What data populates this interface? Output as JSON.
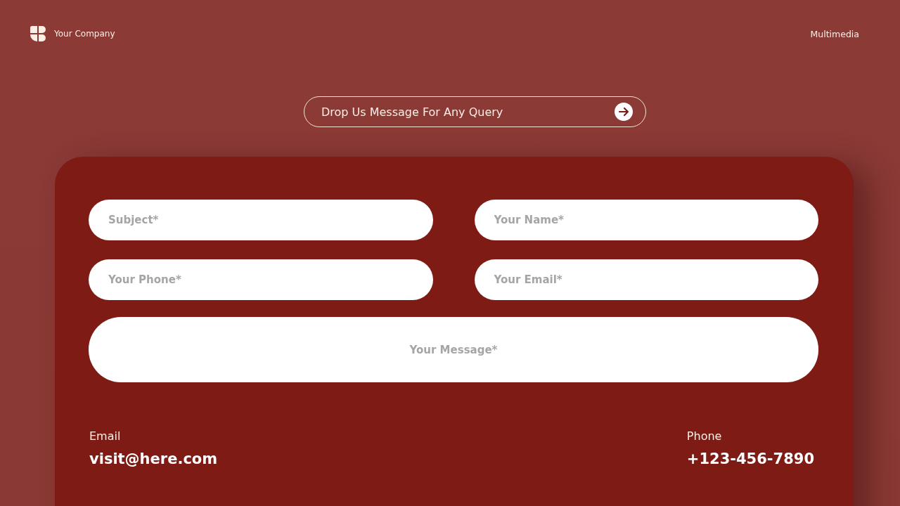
{
  "header": {
    "company": "Your Company",
    "nav_link": "Multimedia"
  },
  "query_button": {
    "label": "Drop Us Message For Any Query"
  },
  "form": {
    "fields": [
      {
        "kind": "input",
        "placeholder": "Subject*"
      },
      {
        "kind": "input",
        "placeholder": "Your Name*"
      },
      {
        "kind": "input",
        "placeholder": "Your Phone*"
      },
      {
        "kind": "input",
        "placeholder": "Your Email*"
      },
      {
        "kind": "message",
        "placeholder": "Your Message*"
      }
    ]
  },
  "contacts": [
    {
      "label": "Email",
      "value": "visit@here.com"
    },
    {
      "label": "Phone",
      "value": "+123-456-7890"
    }
  ]
}
